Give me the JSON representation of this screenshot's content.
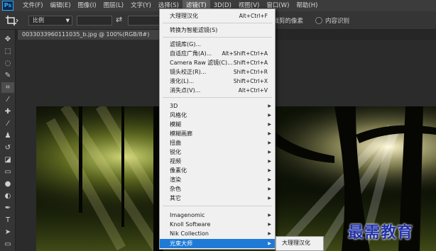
{
  "app": {
    "logo": "Ps"
  },
  "menubar": {
    "items": [
      "文件(F)",
      "编辑(E)",
      "图像(I)",
      "图层(L)",
      "文字(Y)",
      "选择(S)",
      "滤镜(T)",
      "3D(D)",
      "视图(V)",
      "窗口(W)",
      "帮助(H)"
    ],
    "active_index": 6
  },
  "options": {
    "ratio_value": "比例",
    "delete_cropped_label": "除裁剪的像素",
    "content_aware_label": "内容识别"
  },
  "document": {
    "tab_title": "0033033960111035_b.jpg @ 100%(RGB/8#)",
    "close_glyph": "×"
  },
  "filter_menu": {
    "items": [
      {
        "label": "大理理汉化",
        "shortcut": "Alt+Ctrl+F",
        "arrow": false
      },
      {
        "label": "转换为智能滤镜(S)",
        "shortcut": "",
        "arrow": false
      },
      {
        "label": "滤镜库(G)...",
        "shortcut": "",
        "arrow": false
      },
      {
        "label": "自适应广角(A)...",
        "shortcut": "Alt+Shift+Ctrl+A",
        "arrow": false
      },
      {
        "label": "Camera Raw 滤镜(C)...",
        "shortcut": "Shift+Ctrl+A",
        "arrow": false
      },
      {
        "label": "镜头校正(R)...",
        "shortcut": "Shift+Ctrl+R",
        "arrow": false
      },
      {
        "label": "液化(L)...",
        "shortcut": "Shift+Ctrl+X",
        "arrow": false
      },
      {
        "label": "消失点(V)...",
        "shortcut": "Alt+Ctrl+V",
        "arrow": false
      },
      {
        "label": "3D",
        "shortcut": "",
        "arrow": true
      },
      {
        "label": "风格化",
        "shortcut": "",
        "arrow": true
      },
      {
        "label": "模糊",
        "shortcut": "",
        "arrow": true
      },
      {
        "label": "模糊画廊",
        "shortcut": "",
        "arrow": true
      },
      {
        "label": "扭曲",
        "shortcut": "",
        "arrow": true
      },
      {
        "label": "锐化",
        "shortcut": "",
        "arrow": true
      },
      {
        "label": "视频",
        "shortcut": "",
        "arrow": true
      },
      {
        "label": "像素化",
        "shortcut": "",
        "arrow": true
      },
      {
        "label": "渲染",
        "shortcut": "",
        "arrow": true
      },
      {
        "label": "杂色",
        "shortcut": "",
        "arrow": true
      },
      {
        "label": "其它",
        "shortcut": "",
        "arrow": true
      },
      {
        "label": "Imagenomic",
        "shortcut": "",
        "arrow": true
      },
      {
        "label": "Knoll Software",
        "shortcut": "",
        "arrow": true
      },
      {
        "label": "Nik Collection",
        "shortcut": "",
        "arrow": true
      },
      {
        "label": "光束大师",
        "shortcut": "",
        "arrow": true
      }
    ],
    "highlighted_index": 22
  },
  "submenu": {
    "item": "大理理汉化"
  },
  "watermark": "最需教育",
  "colors": {
    "highlight": "#1e7ad6",
    "menu_bg": "#f0f0f0",
    "app_bg": "#282828",
    "watermark": "#2233aa"
  }
}
